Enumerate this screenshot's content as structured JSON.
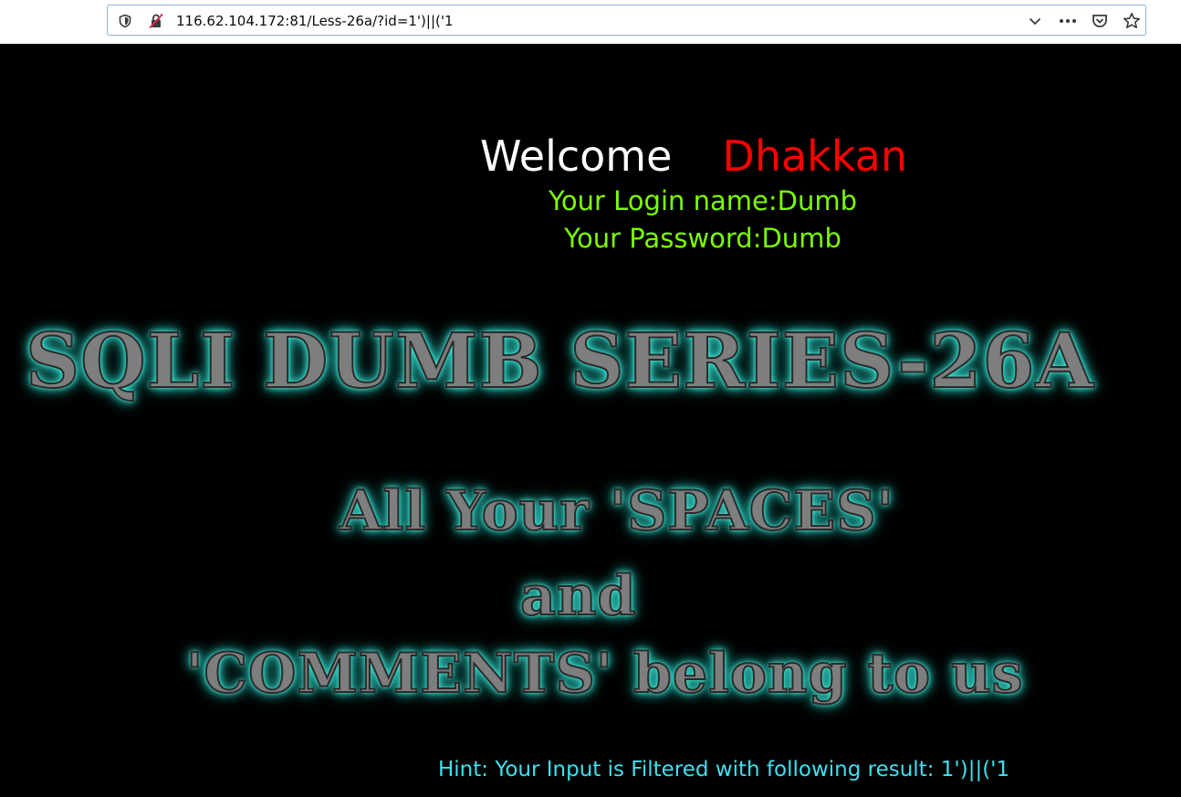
{
  "browser": {
    "url": "116.62.104.172:81/Less-26a/?id=1')||('1",
    "icons": {
      "shield": "shield-icon",
      "insecure": "insecure-connection-icon",
      "dropdown": "chevron-down-icon",
      "more": "more-actions-icon",
      "pocket": "pocket-icon",
      "bookmark": "star-icon"
    }
  },
  "page": {
    "welcome_label": "Welcome",
    "welcome_name": "Dhakkan",
    "login_name_line": "Your Login name:Dumb",
    "password_line": "Your Password:Dumb",
    "banner_title": "SQLI DUMB SERIES-26A",
    "banner_line1": "All Your 'SPACES'",
    "banner_line2": "and",
    "banner_line3": "'COMMENTS' belong to us",
    "hint": "Hint: Your Input is Filtered with following result: 1')||('1"
  },
  "colors": {
    "background": "#000000",
    "welcome": "#ffffff",
    "name": "#ff0000",
    "login_info": "#7cfc00",
    "hint": "#3fe0f0",
    "banner_glow": "#3ee8d8"
  }
}
